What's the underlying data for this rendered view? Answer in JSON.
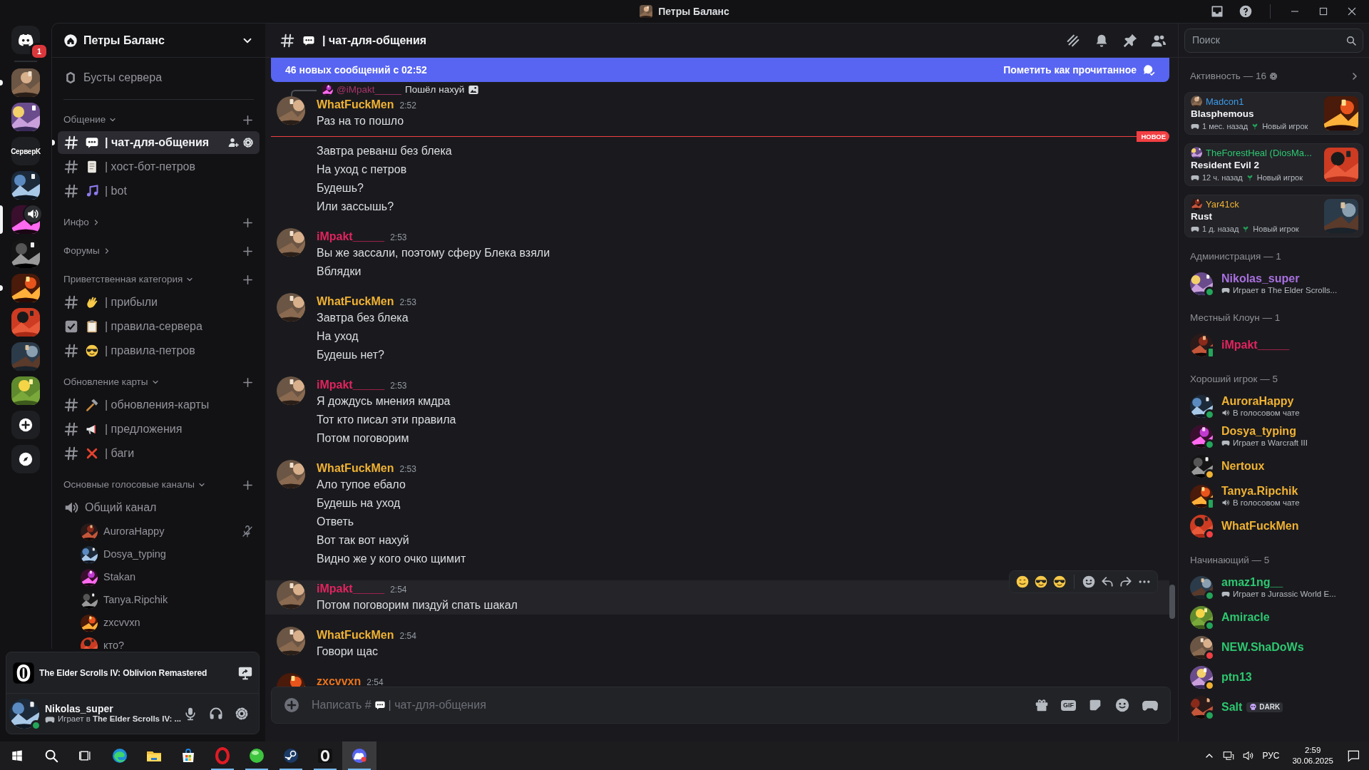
{
  "window": {
    "title": "Петры Баланс"
  },
  "servers": [
    {
      "kind": "home",
      "badge": "1",
      "selected": false,
      "unread": false,
      "voice": false
    },
    {
      "kind": "picture",
      "selected": false,
      "unread": true,
      "voice": false
    },
    {
      "kind": "picture",
      "selected": false,
      "unread": false,
      "voice": false
    },
    {
      "kind": "text",
      "label": "СерверK",
      "selected": false,
      "unread": false,
      "voice": false
    },
    {
      "kind": "picture",
      "selected": false,
      "unread": false,
      "voice": false
    },
    {
      "kind": "picture",
      "selected": true,
      "unread": false,
      "voice": true
    },
    {
      "kind": "picture",
      "selected": false,
      "unread": false,
      "voice": false
    },
    {
      "kind": "picture",
      "selected": false,
      "unread": true,
      "voice": false
    },
    {
      "kind": "picture",
      "selected": false,
      "unread": false,
      "voice": false
    },
    {
      "kind": "picture",
      "selected": false,
      "unread": false,
      "voice": false
    },
    {
      "kind": "picture",
      "selected": false,
      "unread": false,
      "voice": false
    },
    {
      "kind": "add",
      "selected": false,
      "unread": false,
      "voice": false
    },
    {
      "kind": "discover",
      "selected": false,
      "unread": false,
      "voice": false
    }
  ],
  "server": {
    "name": "Петры Баланс"
  },
  "boosts": {
    "label": "Бусты сервера"
  },
  "categories": [
    {
      "name": "Общение",
      "expanded": true,
      "channels": [
        {
          "kind": "text",
          "name": "| чат-для-общения",
          "selected": true,
          "unread": true
        },
        {
          "kind": "text",
          "name": "| хост-бот-петров",
          "selected": false,
          "unread": false
        },
        {
          "kind": "text",
          "name": "| bot",
          "selected": false,
          "unread": false
        }
      ]
    },
    {
      "name": "Инфо",
      "expanded": false
    },
    {
      "name": "Форумы",
      "expanded": false
    },
    {
      "name": "Приветственная категория",
      "expanded": true,
      "channels": [
        {
          "kind": "text",
          "name": "| прибыли",
          "selected": false,
          "unread": false
        },
        {
          "kind": "rules",
          "name": "| правила-сервера",
          "selected": false,
          "unread": false
        },
        {
          "kind": "text",
          "name": "| правила-петров",
          "selected": false,
          "unread": false
        }
      ]
    },
    {
      "name": "Обновление карты",
      "expanded": true,
      "channels": [
        {
          "kind": "text",
          "name": "| обновления-карты",
          "selected": false,
          "unread": false
        },
        {
          "kind": "text",
          "name": "| предложения",
          "selected": false,
          "unread": false
        },
        {
          "kind": "text",
          "name": "| баги",
          "selected": false,
          "unread": false
        }
      ]
    },
    {
      "name": "Основные голосовые каналы",
      "expanded": true,
      "channels": [
        {
          "kind": "voice",
          "name": "Общий канал",
          "selected": false,
          "unread": false,
          "users": [
            {
              "name": "AuroraHappy",
              "muted": true
            },
            {
              "name": "Dosya_typing",
              "muted": false
            },
            {
              "name": "Stakan",
              "muted": false
            },
            {
              "name": "Tanya.Ripchik",
              "muted": false
            },
            {
              "name": "zxcvvxn",
              "muted": false
            },
            {
              "name": "кто?",
              "muted": false
            }
          ]
        }
      ]
    }
  ],
  "activity_panel": {
    "game": "The Elder Scrolls IV: Oblivion Remastered"
  },
  "user": {
    "name": "Nikolas_super",
    "status": {
      "color": "#23a55a",
      "mobile": false
    },
    "status_text": "Играет в **The Elder Scrolls IV: ...**"
  },
  "chat": {
    "channel": "| чат-для-общения",
    "banner": {
      "text": "46 новых сообщений с 02:52",
      "action": "Пометить как прочитанное"
    },
    "messages": [
      {
        "kind": "message",
        "author": "WhatFuckMen",
        "color": "#f0b232",
        "time": "2:52",
        "hovered": false,
        "reply": {
          "author": "@iMpakt_____",
          "text": "Пошёл нахуй"
        },
        "lines": [
          "Раз на то пошло"
        ]
      },
      {
        "kind": "divider",
        "label": "НОВОЕ"
      },
      {
        "kind": "continuation",
        "hovered": false,
        "lines": [
          "Завтра реванш без блека",
          "На уход с петров",
          "Будешь?",
          "Или зассышь?"
        ]
      },
      {
        "kind": "message",
        "author": "iMpakt_____",
        "color": "#e0245e",
        "time": "2:53",
        "hovered": false,
        "lines": [
          "Вы же зассали, поэтому сферу Блека взяли",
          "Вблядки"
        ]
      },
      {
        "kind": "message",
        "author": "WhatFuckMen",
        "color": "#f0b232",
        "time": "2:53",
        "hovered": false,
        "lines": [
          "Завтра без блека",
          "На уход",
          "Будешь нет?"
        ]
      },
      {
        "kind": "message",
        "author": "iMpakt_____",
        "color": "#e0245e",
        "time": "2:53",
        "hovered": false,
        "lines": [
          "Я дождусь мнения кмдра",
          "Тот кто писал эти правила",
          "Потом поговорим"
        ]
      },
      {
        "kind": "message",
        "author": "WhatFuckMen",
        "color": "#f0b232",
        "time": "2:53",
        "hovered": false,
        "lines": [
          "Ало тупое ебало",
          "Будешь на уход",
          "Ответь",
          "Вот так вот нахуй",
          "Видно же у кого очко щимит"
        ]
      },
      {
        "kind": "message",
        "author": "iMpakt_____",
        "color": "#e0245e",
        "time": "2:54",
        "hovered": true,
        "lines": [
          "Потом поговорим пиздуй спать шакал"
        ]
      },
      {
        "kind": "message",
        "author": "WhatFuckMen",
        "color": "#f0b232",
        "time": "2:54",
        "hovered": false,
        "lines": [
          "Говори щас"
        ]
      },
      {
        "kind": "message",
        "author": "zxcvvxn",
        "color": "#e8731c",
        "time": "2:54",
        "hovered": false
      }
    ],
    "composer": {
      "placeholder": "Написать #",
      "placeholder_channel": "| чат-для-общения",
      "gif_label": "GIF"
    }
  },
  "search": {
    "placeholder": "Поиск"
  },
  "activity": {
    "title": "Активность — 16",
    "cards": [
      {
        "user": "Madcon1",
        "color": "#3d9be9",
        "game": "Blasphemous",
        "ago": "1 мес. назад",
        "tag": "Новый игрок"
      },
      {
        "user": "TheForestHeal (DiosMa...",
        "color": "#2dc770",
        "game": "Resident Evil 2",
        "ago": "12 ч. назад",
        "tag": "Новый игрок"
      },
      {
        "user": "Yar41ck",
        "color": "#f0b232",
        "game": "Rust",
        "ago": "1 д. назад",
        "tag": "Новый игрок"
      }
    ]
  },
  "member_groups": [
    {
      "title": "Администрация — 1",
      "members": [
        {
          "name": "Nikolas_super",
          "color": "#a970e0",
          "status": {
            "color": "#23a55a",
            "mobile": false
          },
          "activity": {
            "kind": "game",
            "text": "Играет в The Elder Scrolls..."
          }
        }
      ]
    },
    {
      "title": "Местный Клоун — 1",
      "members": [
        {
          "name": "iMpakt_____",
          "color": "#e0245e",
          "status": {
            "color": "#23a55a",
            "mobile": true
          }
        }
      ]
    },
    {
      "title": "Хороший игрок — 5",
      "members": [
        {
          "name": "AuroraHappy",
          "color": "#f0b232",
          "status": {
            "color": "#23a55a",
            "mobile": false
          },
          "activity": {
            "kind": "voice",
            "text": "В голосовом чате"
          }
        },
        {
          "name": "Dosya_typing",
          "color": "#f0b232",
          "status": {
            "color": "#23a55a",
            "mobile": false
          },
          "activity": {
            "kind": "game",
            "text": "Играет в Warcraft III"
          }
        },
        {
          "name": "Nertoux",
          "color": "#f0b232",
          "status": {
            "color": "#f0b232",
            "mobile": false
          }
        },
        {
          "name": "Tanya.Ripchik",
          "color": "#f0b232",
          "status": {
            "color": "#23a55a",
            "mobile": true
          },
          "activity": {
            "kind": "voice",
            "text": "В голосовом чате"
          }
        },
        {
          "name": "WhatFuckMen",
          "color": "#f0b232",
          "status": {
            "color": "#f23f43",
            "mobile": false
          }
        }
      ]
    },
    {
      "title": "Начинающий — 5",
      "members": [
        {
          "name": "amaz1ng__",
          "color": "#2dc770",
          "status": {
            "color": "#23a55a",
            "mobile": false
          },
          "activity": {
            "kind": "game",
            "text": "Играет в Jurassic World E..."
          }
        },
        {
          "name": "Amiracle",
          "color": "#2dc770",
          "status": {
            "color": "#23a55a",
            "mobile": false
          }
        },
        {
          "name": "NEW.ShaDoWs",
          "color": "#2dc770",
          "status": {
            "color": "#f23f43",
            "mobile": false
          }
        },
        {
          "name": "ptn13",
          "color": "#2dc770",
          "status": {
            "color": "#f0b232",
            "mobile": false
          }
        },
        {
          "name": "Salt",
          "color": "#2dc770",
          "status": {
            "color": "#23a55a",
            "mobile": false
          },
          "tag": "DARK"
        }
      ]
    }
  ],
  "taskbar": {
    "apps": [
      {
        "kind": "browser",
        "running": false,
        "selected": false
      },
      {
        "kind": "folder",
        "running": false,
        "selected": false
      },
      {
        "kind": "store",
        "running": false,
        "selected": false
      },
      {
        "kind": "ring",
        "running": true,
        "selected": false
      },
      {
        "kind": "orb",
        "running": true,
        "selected": false
      },
      {
        "kind": "steam",
        "running": true,
        "selected": false
      },
      {
        "kind": "shield",
        "running": true,
        "selected": false
      },
      {
        "kind": "chat",
        "running": true,
        "selected": true
      }
    ],
    "language": "РУС",
    "time": "2:59",
    "date": "30.06.2025"
  }
}
